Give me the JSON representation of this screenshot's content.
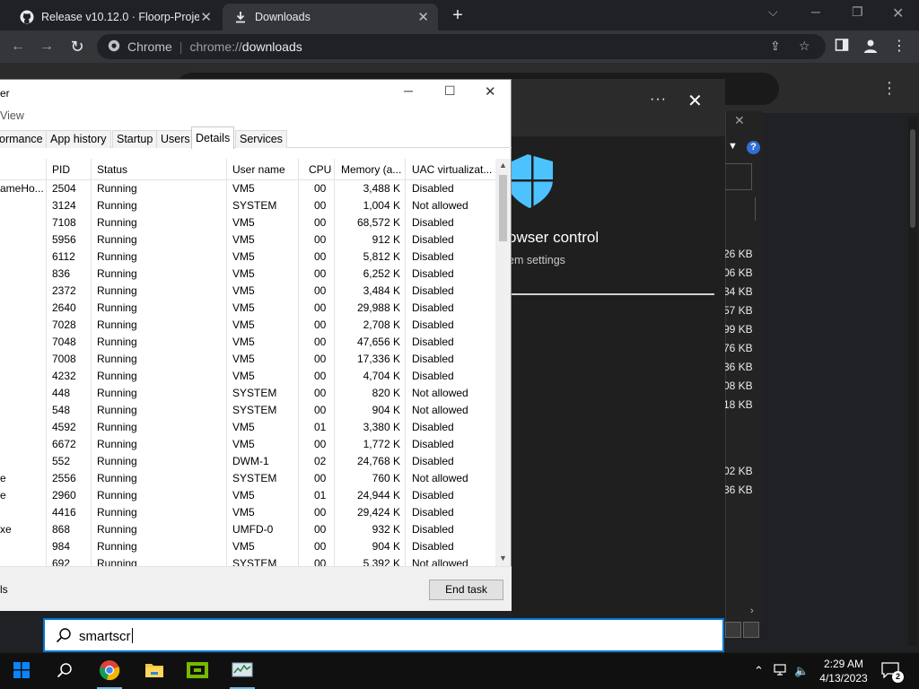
{
  "chrome": {
    "tabs": [
      {
        "title": "Release v10.12.0 · Floorp-Projects/Floorp",
        "icon": "github-icon"
      },
      {
        "title": "Downloads",
        "icon": "download-icon"
      }
    ],
    "omnibox": {
      "chip": "Chrome",
      "scheme": "chrome://",
      "path": "downloads"
    }
  },
  "downloads": {
    "sizes": [
      "26 KB",
      "06 KB",
      "34 KB",
      "57 KB",
      "99 KB",
      "76 KB",
      "36 KB",
      "08 KB",
      "18 KB",
      "02 KB",
      "36 KB"
    ]
  },
  "security_dialog": {
    "title": "owser control",
    "subtitle": "em settings",
    "more_label": "···",
    "accent_color": "#4cc2ff"
  },
  "task_manager": {
    "title": "er",
    "menu": "View",
    "tabs": [
      "ormance",
      "App history",
      "Startup",
      "Users",
      "Details",
      "Services"
    ],
    "active_tab": "Details",
    "columns": [
      "PID",
      "Status",
      "User name",
      "CPU",
      "Memory (a...",
      "UAC virtualizat..."
    ],
    "rows": [
      {
        "name": "ameHo...",
        "pid": "2504",
        "status": "Running",
        "user": "VM5",
        "cpu": "00",
        "mem": "3,488 K",
        "uac": "Disabled"
      },
      {
        "name": "",
        "pid": "3124",
        "status": "Running",
        "user": "SYSTEM",
        "cpu": "00",
        "mem": "1,004 K",
        "uac": "Not allowed"
      },
      {
        "name": "",
        "pid": "7108",
        "status": "Running",
        "user": "VM5",
        "cpu": "00",
        "mem": "68,572 K",
        "uac": "Disabled"
      },
      {
        "name": "",
        "pid": "5956",
        "status": "Running",
        "user": "VM5",
        "cpu": "00",
        "mem": "912 K",
        "uac": "Disabled"
      },
      {
        "name": "",
        "pid": "6112",
        "status": "Running",
        "user": "VM5",
        "cpu": "00",
        "mem": "5,812 K",
        "uac": "Disabled"
      },
      {
        "name": "",
        "pid": "836",
        "status": "Running",
        "user": "VM5",
        "cpu": "00",
        "mem": "6,252 K",
        "uac": "Disabled"
      },
      {
        "name": "",
        "pid": "2372",
        "status": "Running",
        "user": "VM5",
        "cpu": "00",
        "mem": "3,484 K",
        "uac": "Disabled"
      },
      {
        "name": "",
        "pid": "2640",
        "status": "Running",
        "user": "VM5",
        "cpu": "00",
        "mem": "29,988 K",
        "uac": "Disabled"
      },
      {
        "name": "",
        "pid": "7028",
        "status": "Running",
        "user": "VM5",
        "cpu": "00",
        "mem": "2,708 K",
        "uac": "Disabled"
      },
      {
        "name": "",
        "pid": "7048",
        "status": "Running",
        "user": "VM5",
        "cpu": "00",
        "mem": "47,656 K",
        "uac": "Disabled"
      },
      {
        "name": "",
        "pid": "7008",
        "status": "Running",
        "user": "VM5",
        "cpu": "00",
        "mem": "17,336 K",
        "uac": "Disabled"
      },
      {
        "name": "",
        "pid": "4232",
        "status": "Running",
        "user": "VM5",
        "cpu": "00",
        "mem": "4,704 K",
        "uac": "Disabled"
      },
      {
        "name": "",
        "pid": "448",
        "status": "Running",
        "user": "SYSTEM",
        "cpu": "00",
        "mem": "820 K",
        "uac": "Not allowed"
      },
      {
        "name": "",
        "pid": "548",
        "status": "Running",
        "user": "SYSTEM",
        "cpu": "00",
        "mem": "904 K",
        "uac": "Not allowed"
      },
      {
        "name": "",
        "pid": "4592",
        "status": "Running",
        "user": "VM5",
        "cpu": "01",
        "mem": "3,380 K",
        "uac": "Disabled"
      },
      {
        "name": "",
        "pid": "6672",
        "status": "Running",
        "user": "VM5",
        "cpu": "00",
        "mem": "1,772 K",
        "uac": "Disabled"
      },
      {
        "name": "",
        "pid": "552",
        "status": "Running",
        "user": "DWM-1",
        "cpu": "02",
        "mem": "24,768 K",
        "uac": "Disabled"
      },
      {
        "name": "e",
        "pid": "2556",
        "status": "Running",
        "user": "SYSTEM",
        "cpu": "00",
        "mem": "760 K",
        "uac": "Not allowed"
      },
      {
        "name": "e",
        "pid": "2960",
        "status": "Running",
        "user": "VM5",
        "cpu": "01",
        "mem": "24,944 K",
        "uac": "Disabled"
      },
      {
        "name": "",
        "pid": "4416",
        "status": "Running",
        "user": "VM5",
        "cpu": "00",
        "mem": "29,424 K",
        "uac": "Disabled"
      },
      {
        "name": "xe",
        "pid": "868",
        "status": "Running",
        "user": "UMFD-0",
        "cpu": "00",
        "mem": "932 K",
        "uac": "Disabled"
      },
      {
        "name": "",
        "pid": "984",
        "status": "Running",
        "user": "VM5",
        "cpu": "00",
        "mem": "904 K",
        "uac": "Disabled"
      },
      {
        "name": "",
        "pid": "692",
        "status": "Running",
        "user": "SYSTEM",
        "cpu": "00",
        "mem": "5,392 K",
        "uac": "Not allowed"
      }
    ],
    "fewer_details": "ls",
    "end_task": "End task"
  },
  "search": {
    "query": "smartscr"
  },
  "taskbar": {
    "apps": [
      "start-icon",
      "search-icon",
      "chrome-icon",
      "file-explorer-icon",
      "nvidia-icon",
      "task-manager-icon"
    ],
    "time": "2:29 AM",
    "date": "4/13/2023",
    "notification_count": "2"
  }
}
